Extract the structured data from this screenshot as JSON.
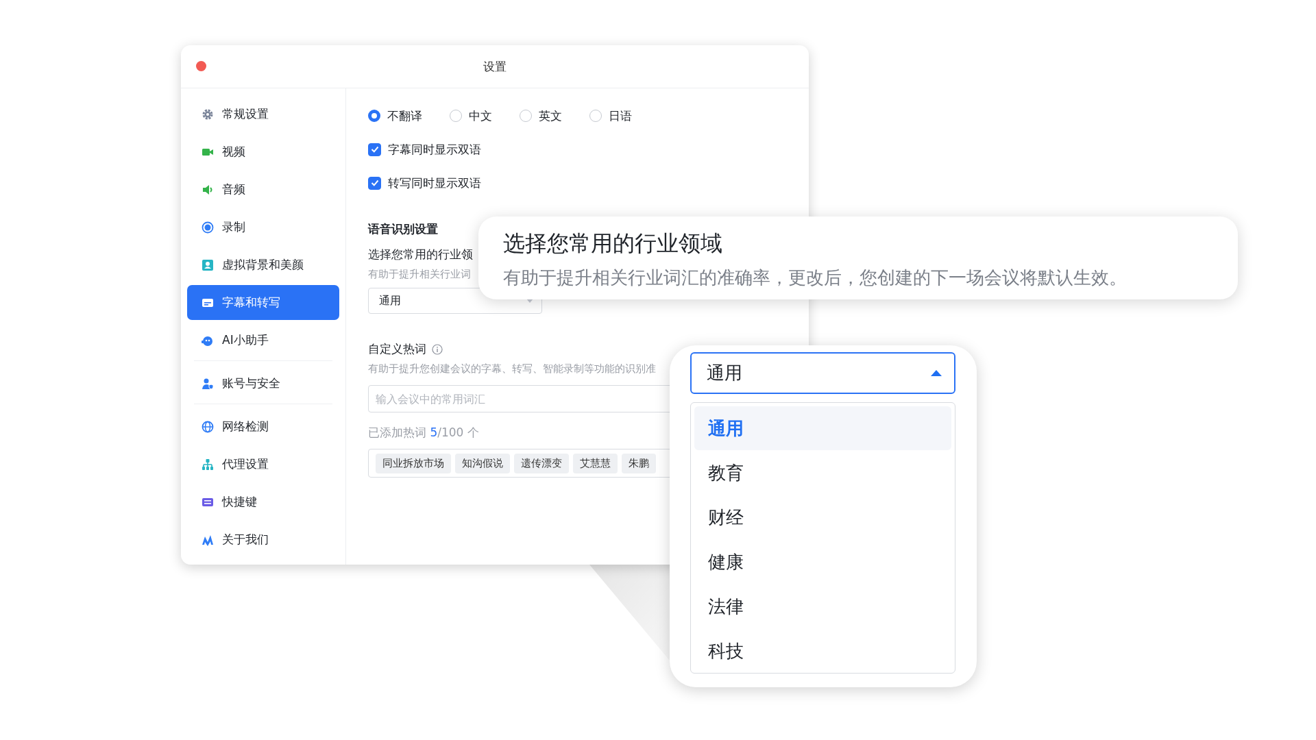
{
  "window": {
    "title": "设置"
  },
  "sidebar": {
    "groups": [
      [
        {
          "label": "常规设置",
          "selected": false
        },
        {
          "label": "视频",
          "selected": false
        },
        {
          "label": "音频",
          "selected": false
        },
        {
          "label": "录制",
          "selected": false
        },
        {
          "label": "虚拟背景和美颜",
          "selected": false
        },
        {
          "label": "字幕和转写",
          "selected": true
        },
        {
          "label": "AI小助手",
          "selected": false
        }
      ],
      [
        {
          "label": "账号与安全",
          "selected": false
        }
      ],
      [
        {
          "label": "网络检测",
          "selected": false
        },
        {
          "label": "代理设置",
          "selected": false
        },
        {
          "label": "快捷键",
          "selected": false
        },
        {
          "label": "关于我们",
          "selected": false
        }
      ]
    ]
  },
  "translation": {
    "options": [
      {
        "label": "不翻译",
        "selected": true
      },
      {
        "label": "中文",
        "selected": false
      },
      {
        "label": "英文",
        "selected": false
      },
      {
        "label": "日语",
        "selected": false
      }
    ]
  },
  "checkboxes": [
    {
      "label": "字幕同时显示双语",
      "checked": true
    },
    {
      "label": "转写同时显示双语",
      "checked": true
    }
  ],
  "speech": {
    "heading": "语音识别设置",
    "industry_label": "选择您常用的行业领",
    "industry_hint": "有助于提升相关行业词",
    "industry_select": {
      "value": "通用"
    }
  },
  "hotwords": {
    "heading": "自定义热词",
    "hint": "有助于提升您创建会议的字幕、转写、智能录制等功能的识别准",
    "input": {
      "placeholder": "输入会议中的常用词汇"
    },
    "count_label": "已添加热词",
    "count": "5",
    "count_total": "/100 个",
    "tags": [
      "同业拆放市场",
      "知沟假说",
      "遗传漂变",
      "艾慧慧",
      "朱鹏"
    ]
  },
  "callout": {
    "title": "选择您常用的行业领域",
    "text": "有助于提升相关行业词汇的准确率，更改后，您创建的下一场会议将默认生效。"
  },
  "dropdown": {
    "value": "通用",
    "expanded": true,
    "options": [
      {
        "label": "通用",
        "selected": true
      },
      {
        "label": "教育",
        "selected": false
      },
      {
        "label": "财经",
        "selected": false
      },
      {
        "label": "健康",
        "selected": false
      },
      {
        "label": "法律",
        "selected": false
      },
      {
        "label": "科技",
        "selected": false
      }
    ]
  }
}
